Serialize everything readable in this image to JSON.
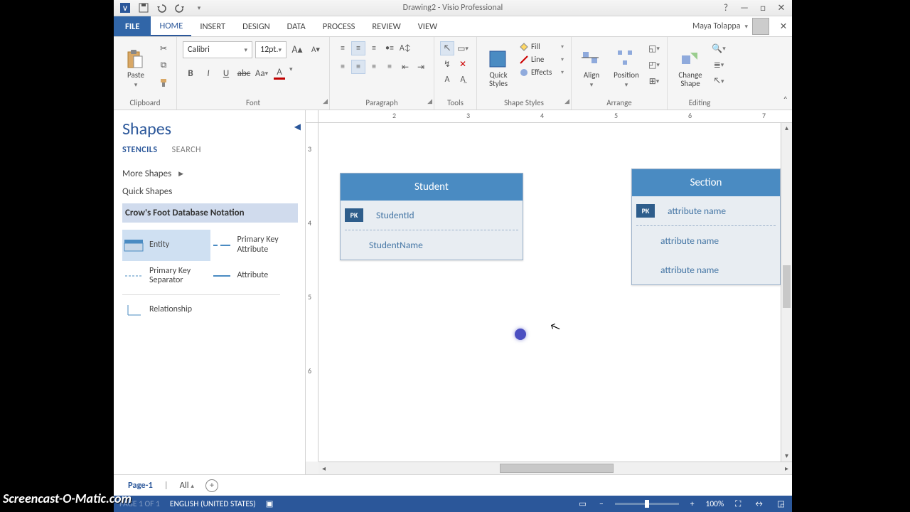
{
  "title_bar": {
    "document_title": "Drawing2 - Visio Professional"
  },
  "ribbon_tabs": {
    "file": "FILE",
    "tabs": [
      "HOME",
      "INSERT",
      "DESIGN",
      "DATA",
      "PROCESS",
      "REVIEW",
      "VIEW"
    ],
    "active": "HOME",
    "user": "Maya Tolappa"
  },
  "ribbon": {
    "clipboard": {
      "paste": "Paste",
      "label": "Clipboard"
    },
    "font": {
      "name": "Calibri",
      "size": "12pt.",
      "label": "Font"
    },
    "paragraph": {
      "label": "Paragraph"
    },
    "tools": {
      "label": "Tools"
    },
    "shape_styles": {
      "quick_styles": "Quick Styles",
      "fill": "Fill",
      "line": "Line",
      "effects": "Effects",
      "label": "Shape Styles"
    },
    "arrange": {
      "align": "Align",
      "position": "Position",
      "label": "Arrange"
    },
    "editing": {
      "change_shape": "Change Shape",
      "label": "Editing"
    }
  },
  "shapes_pane": {
    "title": "Shapes",
    "tab_stencils": "STENCILS",
    "tab_search": "SEARCH",
    "more_shapes": "More Shapes",
    "quick_shapes": "Quick Shapes",
    "stencil_title": "Crow's Foot Database Notation",
    "items": [
      "Entity",
      "Primary Key Attribute",
      "Primary Key Separator",
      "Attribute",
      "Relationship"
    ]
  },
  "ruler_h": [
    "2",
    "3",
    "4",
    "5",
    "6",
    "7"
  ],
  "ruler_v": [
    "3",
    "4",
    "5",
    "6"
  ],
  "canvas": {
    "entity1": {
      "title": "Student",
      "rows": [
        {
          "pk": true,
          "text": "StudentId"
        },
        {
          "pk": false,
          "text": "StudentName"
        }
      ]
    },
    "entity2": {
      "title": "Section",
      "rows": [
        {
          "pk": true,
          "text": "attribute name"
        },
        {
          "pk": false,
          "text": "attribute name"
        },
        {
          "pk": false,
          "text": "attribute name"
        }
      ]
    }
  },
  "page_tabs": {
    "page": "Page-1",
    "all": "All"
  },
  "status_bar": {
    "language": "ENGLISH (UNITED STATES)",
    "zoom": "100%"
  },
  "watermark": "Screencast-O-Matic.com"
}
